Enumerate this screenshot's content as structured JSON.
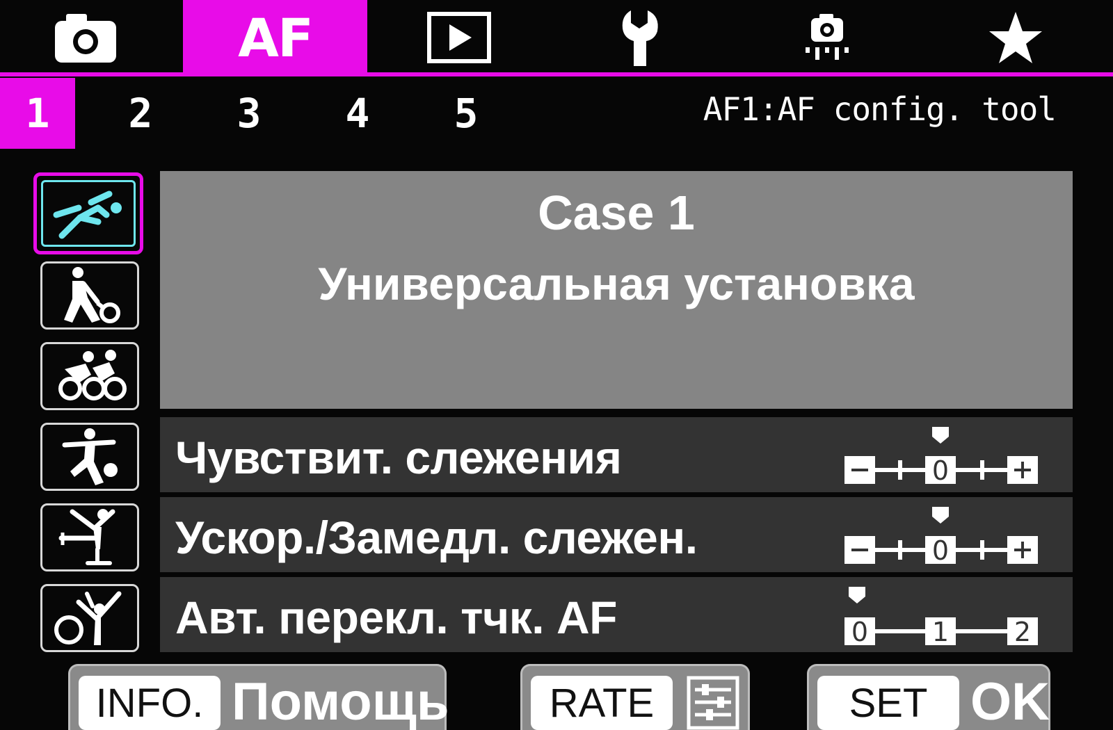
{
  "top_tabs": [
    {
      "icon": "camera-icon"
    },
    {
      "label": "AF",
      "active": true
    },
    {
      "icon": "playback-icon"
    },
    {
      "icon": "wrench-icon"
    },
    {
      "icon": "custom-functions-icon"
    },
    {
      "icon": "star-icon"
    }
  ],
  "sub_tabs": [
    "1",
    "2",
    "3",
    "4",
    "5"
  ],
  "active_sub_tab": "1",
  "page_title": "AF1:AF config. tool",
  "case_icons": [
    "case1-versatile-sprinter-icon",
    "case2-tennis-icon",
    "case3-cyclists-icon",
    "case4-soccer-icon",
    "case5-skater-icon",
    "case6-gymnast-icon"
  ],
  "selected_case_index": 0,
  "case": {
    "title": "Case 1",
    "subtitle": "Универсальная установка"
  },
  "params": [
    {
      "label": "Чувствит. слежения",
      "scale": [
        "−",
        "+",
        "0",
        "+",
        "+"
      ],
      "value": 0
    },
    {
      "label": "Ускор./Замедл. слежен.",
      "scale": [
        "−",
        "+",
        "0",
        "+",
        "+"
      ],
      "value": 0
    },
    {
      "label": "Авт. перекл. тчк. AF",
      "scale": [
        "0",
        "1",
        "2"
      ],
      "value": 0
    }
  ],
  "bottom": {
    "info_key": "INFO.",
    "info_label": "Помощь",
    "rate_key": "RATE",
    "set_key": "SET",
    "set_label": "OK"
  },
  "colors": {
    "accent": "#e80ce8",
    "panel": "#858585",
    "row": "#333333",
    "selection_inner": "#6ee6ee"
  }
}
